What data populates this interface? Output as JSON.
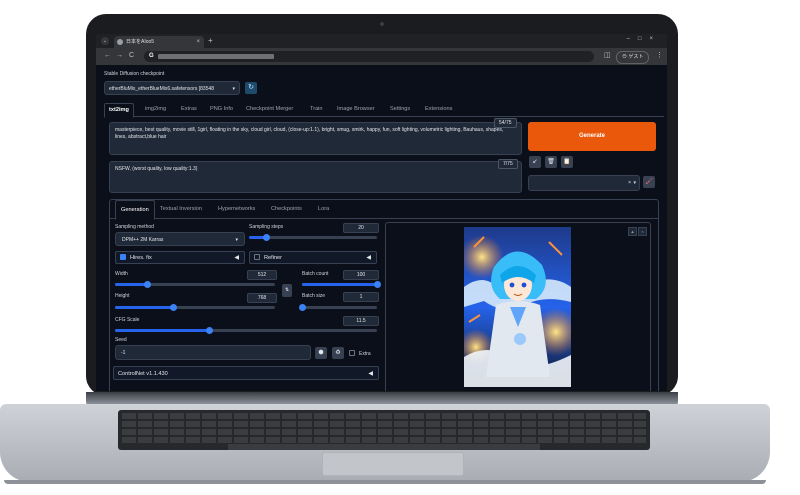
{
  "browser": {
    "tab_title": "日本をAIoo5",
    "tab_close": "×",
    "new_tab": "+",
    "tab_menu": "⌄",
    "window_controls": "–□×",
    "back": "←",
    "forward": "→",
    "reload": "C",
    "omnibox_logo": "G",
    "guest_label": "ゲスト",
    "side_panel": "◫",
    "menu": "⋮"
  },
  "checkpoint": {
    "label": "Stable Diffusion checkpoint",
    "value": "etherBluMix_etherBlueMix6.safetensors [83548",
    "arrow": "▾",
    "refresh_icon": "↻"
  },
  "main_tabs": [
    "txt2img",
    "img2img",
    "Extras",
    "PNG Info",
    "Checkpoint Merger",
    "Train",
    "Image Browser",
    "Settings",
    "Extensions"
  ],
  "prompt": {
    "text": "masterpiece, best quality, movie still, 1girl, floating in the sky, cloud girl, cloud, (close-up:1.1), bright, smug, smirk, happy, fun, soft lighting, volumetric lighting, Bauhaus, shapes, lines, abstract,blue hair",
    "token_count": "54/75"
  },
  "negative_prompt": {
    "text": "NSFW, (worst quality, low quality:1.3)",
    "token_count": "7/75"
  },
  "generate_label": "Generate",
  "tools": {
    "arrow_icon": "↙",
    "trash_icon": "🗑",
    "clipboard_icon": "📋",
    "styles_clear": "×",
    "styles_dropdown": "▾",
    "brush_icon": "🖌"
  },
  "sub_tabs": [
    "Generation",
    "Textual Inversion",
    "Hypernetworks",
    "Checkpoints",
    "Lora"
  ],
  "generation": {
    "sampling_method_label": "Sampling method",
    "sampling_method": "DPM++ 2M Karras",
    "sampling_arrow": "▾",
    "sampling_steps_label": "Sampling steps",
    "sampling_steps": "20",
    "sampling_steps_level": 0.13,
    "hires_fix_label": "Hires. fix",
    "refiner_label": "Refiner",
    "collapse_icon": "◀",
    "width_label": "Width",
    "width": "512",
    "width_level": 0.2,
    "height_label": "Height",
    "height": "768",
    "height_level": 0.36,
    "swap_icon": "⇅",
    "batch_count_label": "Batch count",
    "batch_count": "100",
    "batch_count_level": 1.0,
    "batch_size_label": "Batch size",
    "batch_size": "1",
    "batch_size_level": 0.0,
    "cfg_label": "CFG Scale",
    "cfg": "11.5",
    "cfg_level": 0.36,
    "seed_label": "Seed",
    "seed": "-1",
    "dice_icon": "⬢",
    "recycle_icon": "♻",
    "extra_label": "Extra",
    "controlnet_label": "ControlNet v1.1.430"
  },
  "gallery": {
    "fullscreen_icon": "▲",
    "close_icon": "×"
  },
  "colors": {
    "accent": "#ea580c",
    "slider": "#3b82f6",
    "background": "#0b0f19"
  }
}
